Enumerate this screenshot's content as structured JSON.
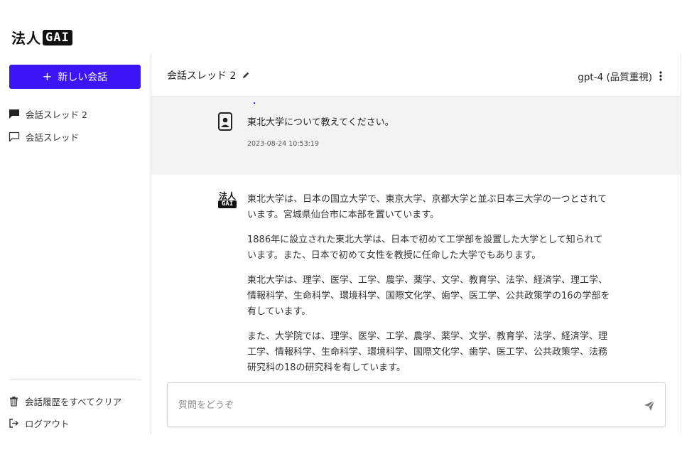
{
  "app": {
    "logo_text": "法人",
    "logo_badge": "GAI"
  },
  "sidebar": {
    "new_chat_label": "新しい会話",
    "threads": [
      {
        "label": "会話スレッド 2",
        "active": true
      },
      {
        "label": "会話スレッド",
        "active": false
      }
    ],
    "clear_history_label": "会話履歴をすべてクリア",
    "logout_label": "ログアウト"
  },
  "header": {
    "thread_title": "会話スレッド 2",
    "model_label": "gpt-4 (品質重視)"
  },
  "messages": {
    "user": {
      "text": "東北大学について教えてください。",
      "timestamp": "2023-08-24 10:53:19"
    },
    "assistant": {
      "avatar_top": "法人",
      "avatar_bottom": "GAI",
      "paragraphs": [
        "東北大学は、日本の国立大学で、東京大学、京都大学と並ぶ日本三大学の一つとされています。宮城県仙台市に本部を置いています。",
        "1886年に設立された東北大学は、日本で初めて工学部を設置した大学として知られています。また、日本で初めて女性を教授に任命した大学でもあります。",
        "東北大学は、理学、医学、工学、農学、薬学、文学、教育学、法学、経済学、理工学、情報科学、生命科学、環境科学、国際文化学、歯学、医工学、公共政策学の16の学部を有しています。",
        "また、大学院では、理学、医学、工学、農学、薬学、文学、教育学、法学、経済学、理工学、情報科学、生命科学、環境科学、国際文化学、歯学、医工学、公共政策学、法務研究科の18の研究科を有しています。"
      ]
    }
  },
  "input": {
    "placeholder": "質問をどうぞ"
  },
  "colors": {
    "accent": "#3b15f5",
    "user_bg": "#f3f3f3"
  }
}
